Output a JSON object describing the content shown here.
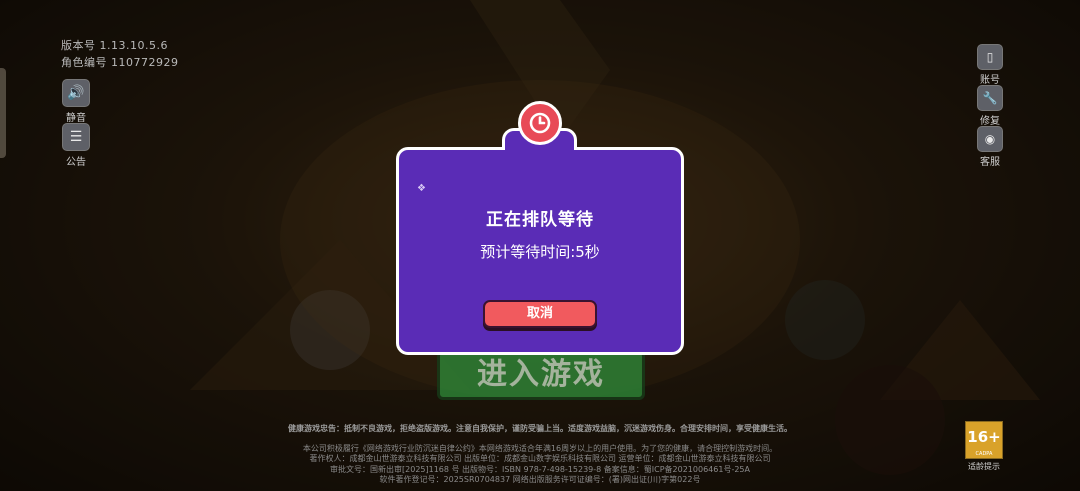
{
  "version_info": {
    "version_line": "版本号 1.13.10.5.6",
    "role_line": "角色编号 110772929"
  },
  "left_buttons": [
    {
      "label": "静音",
      "icon": "speaker-icon"
    },
    {
      "label": "公告",
      "icon": "notice-icon"
    }
  ],
  "right_buttons": [
    {
      "label": "账号",
      "icon": "phone-icon"
    },
    {
      "label": "修复",
      "icon": "wrench-icon"
    },
    {
      "label": "客服",
      "icon": "support-icon"
    }
  ],
  "background": {
    "enter_game_label": "进入游戏"
  },
  "dialog": {
    "title": "正在排队等待",
    "message": "预计等待时间:5秒",
    "cancel_label": "取消"
  },
  "footer": {
    "health_notice": "健康游戏忠告：抵制不良游戏，拒绝盗版游戏。注意自我保护，谨防受骗上当。适度游戏益脑，沉迷游戏伤身。合理安排时间，享受健康生活。",
    "lines": [
      "本公司积极履行《网络游戏行业防沉迷自律公约》本网络游戏适合年满16周岁以上的用户使用。为了您的健康，请合理控制游戏时间。",
      "著作权人：成都金山世游泰立科技有限公司 出版单位：成都金山数字娱乐科技有限公司 运营单位：成都金山世游泰立科技有限公司",
      "审批文号：国新出审[2025]1168 号 出版物号：ISBN 978-7-498-15239-8 备案信息：蜀ICP备2021006461号-25A",
      "软件著作登记号：2025SR0704837 网络出版服务许可证编号：(署)网出证(川)字第022号"
    ]
  },
  "age_rating": {
    "value": "16+",
    "org": "CADPA",
    "label": "适龄提示"
  },
  "colors": {
    "dialog_bg": "#5a2cb6",
    "cancel_button": "#f15a5e",
    "clock_badge": "#e84a57"
  }
}
